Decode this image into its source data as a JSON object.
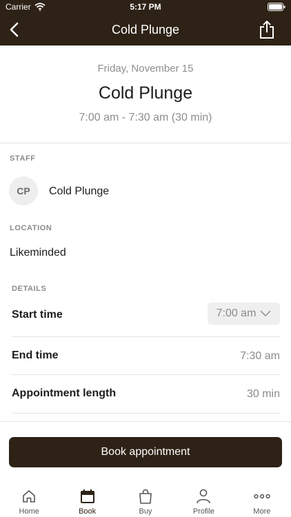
{
  "status": {
    "carrier": "Carrier",
    "time": "5:17 PM"
  },
  "nav": {
    "title": "Cold Plunge"
  },
  "header": {
    "date": "Friday, November 15",
    "session": "Cold Plunge",
    "range": "7:00 am - 7:30 am (30 min)"
  },
  "staff": {
    "label": "STAFF",
    "initials": "CP",
    "name": "Cold Plunge"
  },
  "location": {
    "label": "LOCATION",
    "name": "Likeminded"
  },
  "details": {
    "label": "DETAILS",
    "start_label": "Start time",
    "start_value": "7:00 am",
    "end_label": "End time",
    "end_value": "7:30 am",
    "length_label": "Appointment length",
    "length_value": "30 min"
  },
  "book_label": "Book appointment",
  "tabs": [
    {
      "label": "Home",
      "icon": "home-icon",
      "active": false
    },
    {
      "label": "Book",
      "icon": "calendar-icon",
      "active": true
    },
    {
      "label": "Buy",
      "icon": "shopping-bag-icon",
      "active": false
    },
    {
      "label": "Profile",
      "icon": "person-icon",
      "active": false
    },
    {
      "label": "More",
      "icon": "more-dots-icon",
      "active": false
    }
  ],
  "colors": {
    "brand": "#2e2216",
    "muted": "#8a8a8a"
  }
}
